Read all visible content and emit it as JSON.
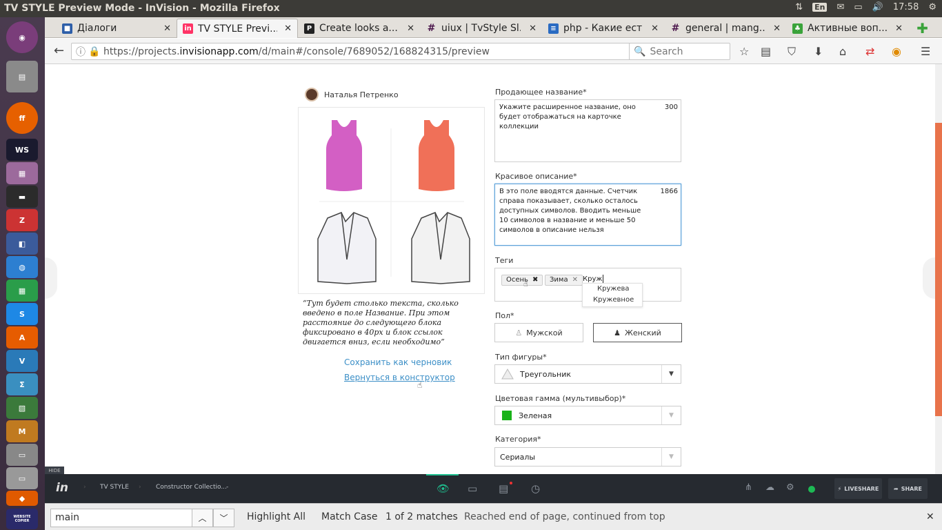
{
  "window": {
    "title": "TV STYLE Preview Mode - InVision - Mozilla Firefox",
    "clock": "17:58",
    "lang": "En"
  },
  "tabs": [
    {
      "label": "Діалоги",
      "icon_color": "#2d5ea8",
      "icon": "chat-icon"
    },
    {
      "label": "TV STYLE Previ...",
      "icon_color": "#ff3366",
      "icon": "invision-icon"
    },
    {
      "label": "Create looks a...",
      "icon_color": "#222222",
      "icon": "p-icon"
    },
    {
      "label": "uiux | TvStyle Sl...",
      "icon_color": "#4a154b",
      "icon": "slack-icon"
    },
    {
      "label": "php - Какие ест...",
      "icon_color": "#2a6bc2",
      "icon": "stackoverflow-icon"
    },
    {
      "label": "general | mang...",
      "icon_color": "#4a154b",
      "icon": "slack-icon"
    },
    {
      "label": "Активные воп...",
      "icon_color": "#3aa33a",
      "icon": "leaf-icon"
    }
  ],
  "nav": {
    "url_pre": "https://projects.",
    "url_domain": "invisionapp.com",
    "url_post": "/d/main#/console/7689052/168824315/preview",
    "search_placeholder": "Search"
  },
  "page": {
    "author": "Наталья Петренко",
    "quote": "“Тут будет столько текста, сколько введено в поле Название. При этом расстояние до следующего блока фиксировано в 40px и блок ссылок двигается вниз, если необходимо”",
    "save_draft": "Сохранить как черновик",
    "back_constructor": "Вернуться в конструктор",
    "sell_name_label": "Продающее название*",
    "sell_name_text": "Укажите расширенное название, оно будет отображаться на карточке коллекции",
    "sell_name_count": "300",
    "desc_label": "Красивое описание*",
    "desc_text": "В это поле вводятся данные. Счетчик справа показывает, сколько осталось доступных символов. Вводить меньше 10 символов в название и меньше 50 символов в описание нельзя",
    "desc_count": "1866",
    "tags_label": "Теги",
    "tags": [
      "Осень",
      "Зима"
    ],
    "tag_input": "Круж",
    "suggestions": [
      "Кружева",
      "Кружевное"
    ],
    "gender_label": "Пол*",
    "gender_male": "Мужской",
    "gender_female": "Женский",
    "figure_label": "Тип фигуры*",
    "figure_value": "Треугольник",
    "color_label": "Цветовая гамма (мультивыбор)*",
    "color_value": "Зеленая",
    "color_swatch": "#19b219",
    "category_label": "Категория*",
    "category_value": "Сериалы"
  },
  "invision": {
    "hide": "HIDE",
    "crumb1": "TV STYLE",
    "crumb2": "Constructor Collectio...",
    "crumb_sep": "-",
    "liveshare": "LIVESHARE",
    "share": "SHARE"
  },
  "find": {
    "query": "main",
    "highlight": "Highlight All",
    "match_case": "Match Case",
    "matches": "1 of 2 matches",
    "status": "Reached end of page, continued from top"
  },
  "launcher": {
    "copier_label": "WEBSITE COPIER"
  }
}
